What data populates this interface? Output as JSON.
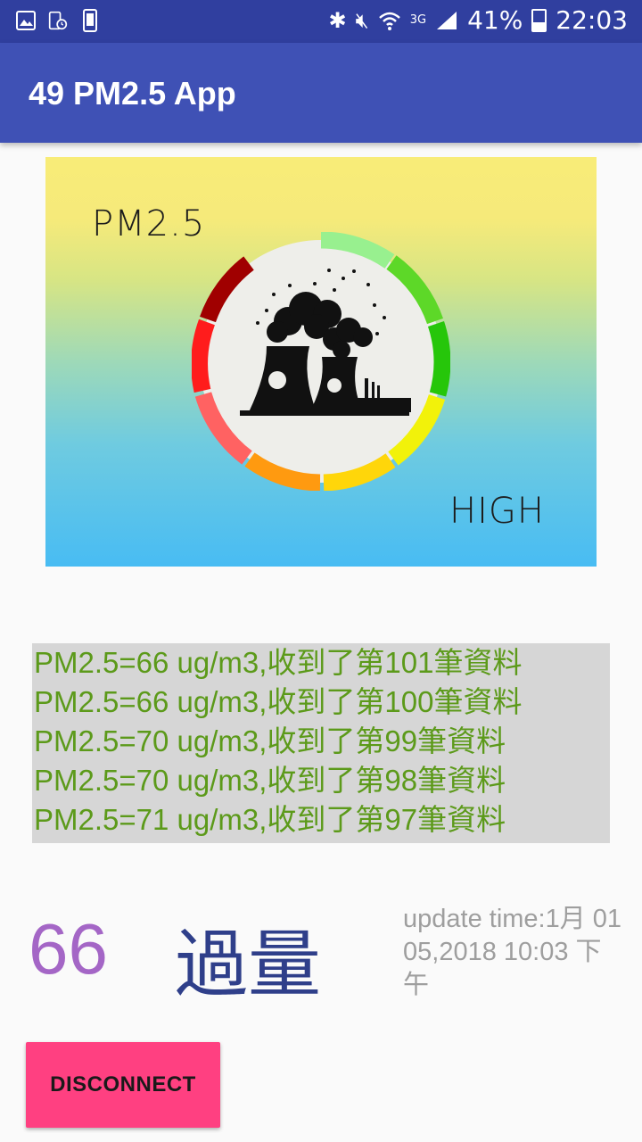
{
  "status_bar": {
    "left_icons": [
      "image-notification-icon",
      "tablet-clock-notification-icon",
      "device-notification-icon"
    ],
    "network_type": "3G",
    "battery_percent": "41%",
    "time": "22:03"
  },
  "app_bar": {
    "title": "49 PM2.5 App"
  },
  "hero": {
    "top_label": "PM2.5",
    "bottom_label": "HIGH"
  },
  "log": {
    "lines": [
      "PM2.5=66 ug/m3,收到了第101筆資料",
      "PM2.5=66 ug/m3,收到了第100筆資料",
      "PM2.5=70 ug/m3,收到了第99筆資料",
      "PM2.5=70 ug/m3,收到了第98筆資料",
      "PM2.5=71 ug/m3,收到了第97筆資料"
    ]
  },
  "reading": {
    "value": "66",
    "status": "過量",
    "update_text": "update time:1月 01 05,2018 10:03 下午"
  },
  "button": {
    "label": "DISCONNECT"
  },
  "colors": {
    "status_bar": "#303f9f",
    "app_bar": "#3f51b5",
    "accent": "#ff4081",
    "log_text": "#5c9a1a",
    "value_text": "#a466c6",
    "status_text": "#2f3f8a"
  }
}
